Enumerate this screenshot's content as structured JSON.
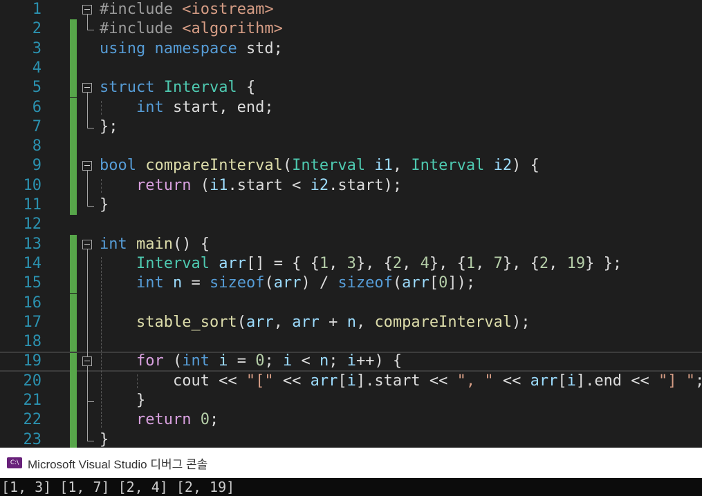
{
  "editor": {
    "line_numbers": [
      "1",
      "2",
      "3",
      "4",
      "5",
      "6",
      "7",
      "8",
      "9",
      "10",
      "11",
      "12",
      "13",
      "14",
      "15",
      "16",
      "17",
      "18",
      "19",
      "20",
      "21",
      "22",
      "23"
    ],
    "lines": [
      [
        [
          "pre",
          "#include "
        ],
        [
          "inc",
          "<iostream>"
        ]
      ],
      [
        [
          "pre",
          "#include "
        ],
        [
          "inc",
          "<algorithm>"
        ]
      ],
      [
        [
          "kw",
          "using "
        ],
        [
          "kw",
          "namespace "
        ],
        [
          "t",
          "std;"
        ]
      ],
      [],
      [
        [
          "kw",
          "struct "
        ],
        [
          "ty",
          "Interval "
        ],
        [
          "t",
          "{"
        ]
      ],
      [
        [
          "t",
          "    "
        ],
        [
          "kw",
          "int "
        ],
        [
          "t",
          "start, end;"
        ]
      ],
      [
        [
          "t",
          "};"
        ]
      ],
      [],
      [
        [
          "kw",
          "bool "
        ],
        [
          "fn",
          "compareInterval"
        ],
        [
          "t",
          "("
        ],
        [
          "ty",
          "Interval "
        ],
        [
          "par",
          "i1"
        ],
        [
          "t",
          ", "
        ],
        [
          "ty",
          "Interval "
        ],
        [
          "par",
          "i2"
        ],
        [
          "t",
          ") {"
        ]
      ],
      [
        [
          "t",
          "    "
        ],
        [
          "ctl",
          "return "
        ],
        [
          "t",
          "("
        ],
        [
          "par",
          "i1"
        ],
        [
          "t",
          ".start < "
        ],
        [
          "par",
          "i2"
        ],
        [
          "t",
          ".start);"
        ]
      ],
      [
        [
          "t",
          "}"
        ]
      ],
      [],
      [
        [
          "kw",
          "int "
        ],
        [
          "fn",
          "main"
        ],
        [
          "t",
          "() {"
        ]
      ],
      [
        [
          "t",
          "    "
        ],
        [
          "ty",
          "Interval "
        ],
        [
          "var",
          "arr"
        ],
        [
          "t",
          "[] = { {"
        ],
        [
          "num",
          "1"
        ],
        [
          "t",
          ", "
        ],
        [
          "num",
          "3"
        ],
        [
          "t",
          "}, {"
        ],
        [
          "num",
          "2"
        ],
        [
          "t",
          ", "
        ],
        [
          "num",
          "4"
        ],
        [
          "t",
          "}, {"
        ],
        [
          "num",
          "1"
        ],
        [
          "t",
          ", "
        ],
        [
          "num",
          "7"
        ],
        [
          "t",
          "}, {"
        ],
        [
          "num",
          "2"
        ],
        [
          "t",
          ", "
        ],
        [
          "num",
          "19"
        ],
        [
          "t",
          "} };"
        ]
      ],
      [
        [
          "t",
          "    "
        ],
        [
          "kw",
          "int "
        ],
        [
          "var",
          "n"
        ],
        [
          "t",
          " = "
        ],
        [
          "kw",
          "sizeof"
        ],
        [
          "t",
          "("
        ],
        [
          "var",
          "arr"
        ],
        [
          "t",
          ") / "
        ],
        [
          "kw",
          "sizeof"
        ],
        [
          "t",
          "("
        ],
        [
          "var",
          "arr"
        ],
        [
          "t",
          "["
        ],
        [
          "num",
          "0"
        ],
        [
          "t",
          "]);"
        ]
      ],
      [],
      [
        [
          "t",
          "    "
        ],
        [
          "fn",
          "stable_sort"
        ],
        [
          "t",
          "("
        ],
        [
          "var",
          "arr"
        ],
        [
          "t",
          ", "
        ],
        [
          "var",
          "arr"
        ],
        [
          "t",
          " + "
        ],
        [
          "var",
          "n"
        ],
        [
          "t",
          ", "
        ],
        [
          "fn",
          "compareInterval"
        ],
        [
          "t",
          ");"
        ]
      ],
      [],
      [
        [
          "t",
          "    "
        ],
        [
          "ctl",
          "for "
        ],
        [
          "t",
          "("
        ],
        [
          "kw",
          "int "
        ],
        [
          "var",
          "i"
        ],
        [
          "t",
          " = "
        ],
        [
          "num",
          "0"
        ],
        [
          "t",
          "; "
        ],
        [
          "var",
          "i"
        ],
        [
          "t",
          " < "
        ],
        [
          "var",
          "n"
        ],
        [
          "t",
          "; "
        ],
        [
          "var",
          "i"
        ],
        [
          "t",
          "++) {"
        ]
      ],
      [
        [
          "t",
          "        cout << "
        ],
        [
          "str",
          "\"[\""
        ],
        [
          "t",
          " << "
        ],
        [
          "var",
          "arr"
        ],
        [
          "t",
          "["
        ],
        [
          "var",
          "i"
        ],
        [
          "t",
          "].start << "
        ],
        [
          "str",
          "\", \""
        ],
        [
          "t",
          " << "
        ],
        [
          "var",
          "arr"
        ],
        [
          "t",
          "["
        ],
        [
          "var",
          "i"
        ],
        [
          "t",
          "].end << "
        ],
        [
          "str",
          "\"] \""
        ],
        [
          "t",
          ";"
        ]
      ],
      [
        [
          "t",
          "    }"
        ]
      ],
      [
        [
          "t",
          "    "
        ],
        [
          "ctl",
          "return "
        ],
        [
          "num",
          "0"
        ],
        [
          "t",
          ";"
        ]
      ],
      [
        [
          "t",
          "}"
        ]
      ]
    ]
  },
  "console": {
    "icon_label": "C:\\",
    "title": "Microsoft Visual Studio 디버그 콘솔",
    "output": "[1, 3] [1, 7] [2, 4] [2, 19]"
  }
}
